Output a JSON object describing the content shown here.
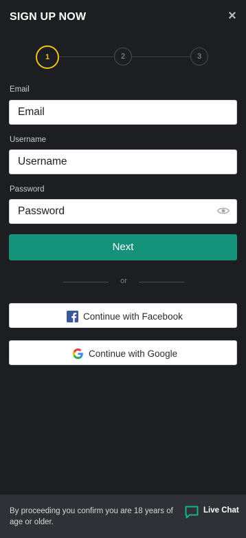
{
  "header": {
    "title": "SIGN UP NOW",
    "close_symbol": "×"
  },
  "stepper": {
    "steps": [
      "1",
      "2",
      "3"
    ],
    "active_step": 1
  },
  "form": {
    "email": {
      "label": "Email",
      "placeholder": "Email",
      "value": ""
    },
    "username": {
      "label": "Username",
      "placeholder": "Username",
      "value": ""
    },
    "password": {
      "label": "Password",
      "placeholder": "Password",
      "value": "",
      "toggle_icon": "eye-icon"
    },
    "next_label": "Next"
  },
  "divider": {
    "text": "or"
  },
  "social": {
    "facebook_label": "Continue with Facebook",
    "facebook_icon": "facebook-icon",
    "google_label": "Continue with Google",
    "google_icon": "google-icon"
  },
  "footer": {
    "notice": "By proceeding you confirm you are 18 years of age or older.",
    "live_chat_label": "Live Chat",
    "live_chat_icon": "chat-bubble-icon"
  },
  "colors": {
    "background": "#1c1e21",
    "accent": "#14927a",
    "active_step": "#f0c419",
    "footer": "#2e3135",
    "facebook": "#3b5998"
  }
}
